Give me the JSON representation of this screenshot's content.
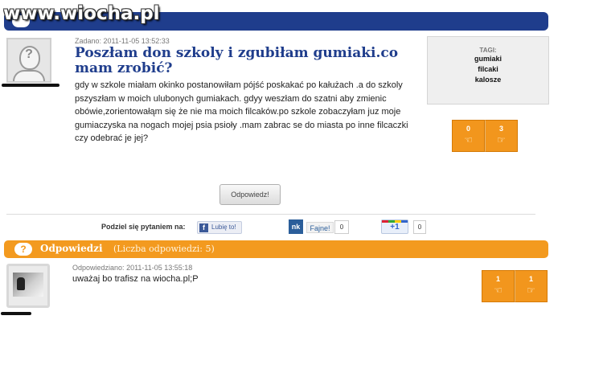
{
  "watermark": "www.wiocha.pl",
  "question": {
    "added_prefix": "Zadano:",
    "added_date": "2011-11-05 13:52:33",
    "title": "Poszłam don szkoly i zgubiłam gumiaki.co mam zrobić?",
    "body": "gdy w szkole miałam okinko postanowiłam pójść poskakać po kałużach .a do szkoly pszyszłam w moich ulubonych gumiakach. gdyy weszłam do szatni aby zmienic obówie,zorientowałąm się że nie ma moich filcaków.po szkole zobaczyłam juz moje gumiaczyska na nogach mojej psia psioły .mam zabrac se do miasta po inne filcaczki czy odebrać je jej?",
    "votes_up": "0",
    "votes_down": "3",
    "answer_button": "Odpowiedz!"
  },
  "tags": {
    "label": "TAGI:",
    "items": [
      "gumiaki",
      "filcaki",
      "kalosze"
    ]
  },
  "share": {
    "label": "Podziel się pytaniem na:",
    "facebook": "Lubię to!",
    "nk_logo": "nk",
    "nk_label": "Fajne!",
    "nk_count": "0",
    "gplus_label": "+1",
    "gplus_count": "0"
  },
  "answers": {
    "title": "Odpowiedzi",
    "count_text": "(Liczba odpowiedzi: 5)",
    "items": [
      {
        "answered_prefix": "Odpowiedziano:",
        "answered_date": "2011-11-05 13:55:18",
        "text": "uważaj bo trafisz na wiocha.pl;P",
        "votes_up": "1",
        "votes_down": "1"
      }
    ]
  },
  "colors": {
    "header_blue": "#1f3d8c",
    "accent_orange": "#f39a1f"
  }
}
